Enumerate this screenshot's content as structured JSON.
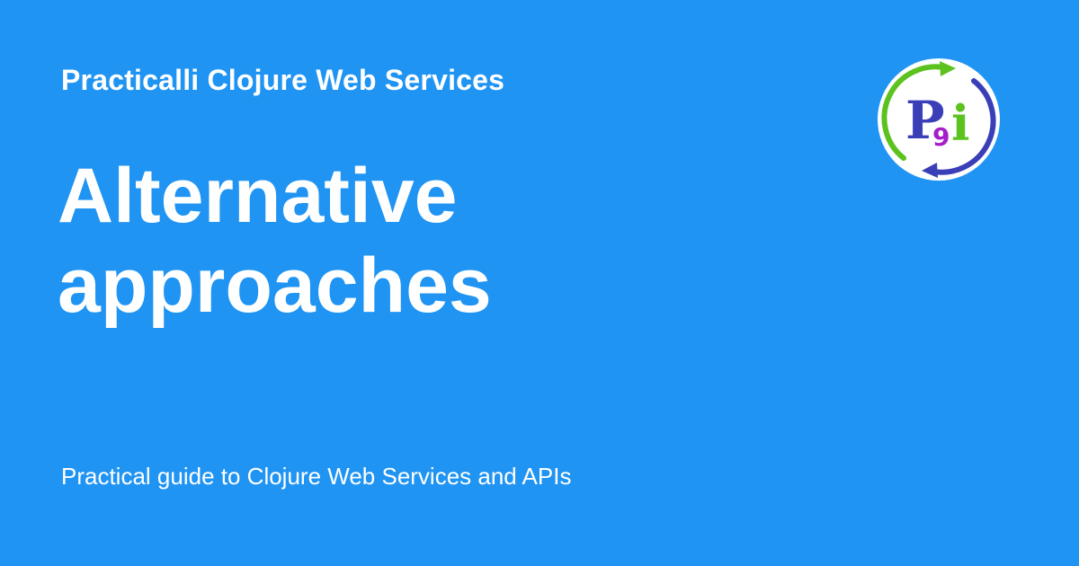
{
  "header": {
    "site_name": "Practicalli Clojure Web Services"
  },
  "main": {
    "title": "Alternative approaches",
    "description": "Practical guide to Clojure Web Services and APIs"
  },
  "logo": {
    "icon": "practicalli-logo",
    "letters": [
      "P",
      "9",
      "i"
    ]
  },
  "colors": {
    "background": "#2094f3",
    "text": "#ffffff",
    "logo_blue": "#3a3fb8",
    "logo_green": "#5cc21f",
    "logo_purple": "#a51fc9"
  }
}
